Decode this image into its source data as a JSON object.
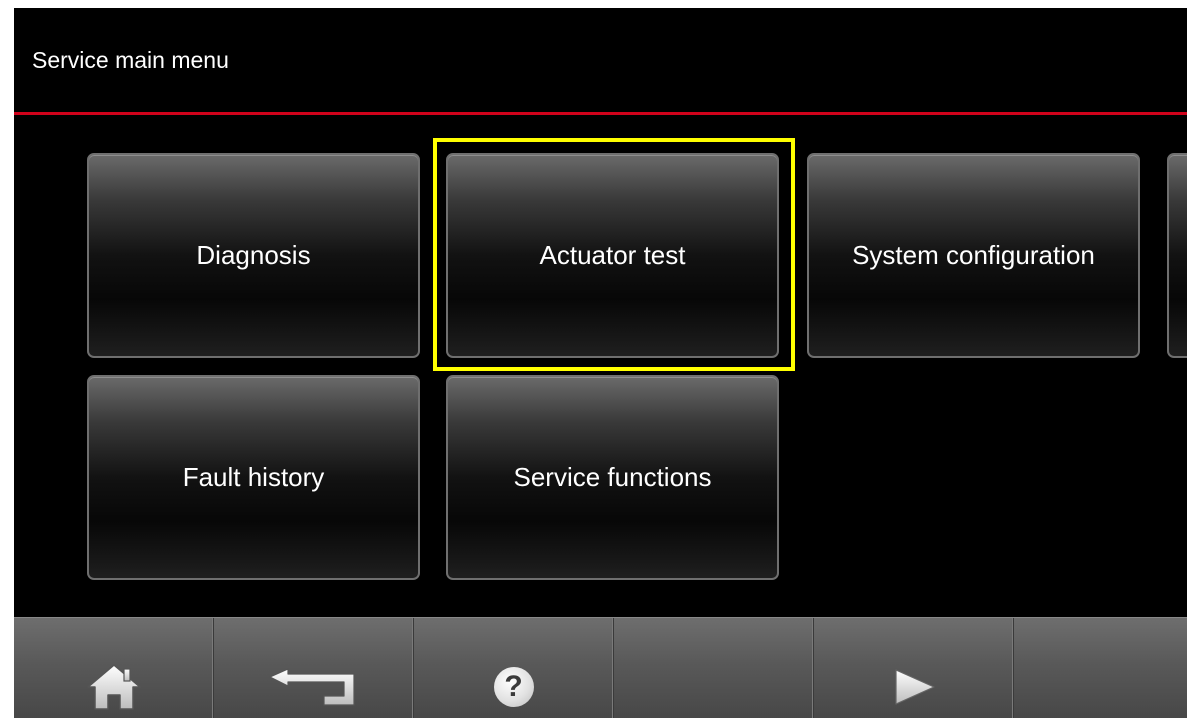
{
  "header": {
    "title": "Service main menu"
  },
  "colors": {
    "accent_line": "#d0021b",
    "highlight": "#ffff00",
    "background": "#000000"
  },
  "menu": {
    "diagnosis": "Diagnosis",
    "actuator_test": "Actuator test",
    "system_configuration": "System configuration",
    "fault_history": "Fault history",
    "service_functions": "Service functions",
    "highlighted": "Actuator test"
  },
  "toolbar": {
    "icons": [
      "home-icon",
      "back-arrow-icon",
      "help-icon",
      "",
      "next-arrow-icon",
      ""
    ],
    "help_glyph": "?"
  }
}
